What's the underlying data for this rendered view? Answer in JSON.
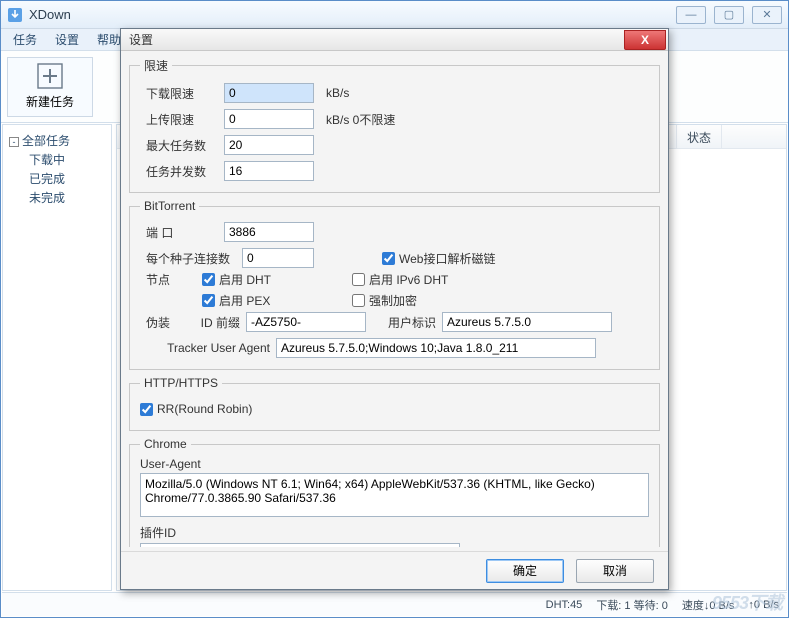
{
  "app": {
    "title": "XDown"
  },
  "win_controls": {
    "min": "—",
    "max": "▢",
    "close": "✕"
  },
  "menubar": {
    "tasks": "任务",
    "settings": "设置",
    "help": "帮助"
  },
  "toolbar": {
    "new_task": "新建任务"
  },
  "sidebar": {
    "toggle_glyph": "-",
    "root": "全部任务",
    "downloading": "下载中",
    "completed": "已完成",
    "unfinished": "未完成"
  },
  "list": {
    "col_status": "状态"
  },
  "statusbar": {
    "dht": "DHT:45",
    "queue": "下载: 1 等待: 0",
    "speed": "速度↓0 B/s",
    "up": "↑0 B/s"
  },
  "dialog": {
    "title": "设置",
    "close_glyph": "X",
    "ratelimit": {
      "legend": "限速",
      "download_label": "下载限速",
      "download_value": "0",
      "kbs": "kB/s",
      "upload_label": "上传限速",
      "upload_value": "0",
      "upload_hint": "kB/s   0不限速",
      "max_tasks_label": "最大任务数",
      "max_tasks_value": "20",
      "concurrency_label": "任务并发数",
      "concurrency_value": "16"
    },
    "bt": {
      "legend": "BitTorrent",
      "port_label": "端 口",
      "port_value": "3886",
      "peers_label": "每个种子连接数",
      "peers_value": "0",
      "web_magnet_label": "Web接口解析磁链",
      "nodes_label": "节点",
      "dht_label": "启用 DHT",
      "dht6_label": "启用 IPv6 DHT",
      "pex_label": "启用 PEX",
      "forceenc_label": "强制加密",
      "spoof_label": "伪装",
      "idprefix_label": "ID 前缀",
      "idprefix_value": "-AZ5750-",
      "userident_label": "用户标识",
      "userident_value": "Azureus 5.7.5.0",
      "tracker_ua_label": "Tracker User Agent",
      "tracker_ua_value": "Azureus 5.7.5.0;Windows 10;Java 1.8.0_211"
    },
    "http": {
      "legend": "HTTP/HTTPS",
      "rr_label": "RR(Round Robin)"
    },
    "chrome": {
      "legend": "Chrome",
      "ua_label": "User-Agent",
      "ua_value": "Mozilla/5.0 (Windows NT 6.1; Win64; x64) AppleWebKit/537.36 (KHTML, like Gecko) Chrome/77.0.3865.90 Safari/537.36",
      "plugin_label": "插件ID",
      "plugin_value": ""
    },
    "buttons": {
      "ok": "确定",
      "cancel": "取消"
    }
  },
  "watermark": "9553下载"
}
